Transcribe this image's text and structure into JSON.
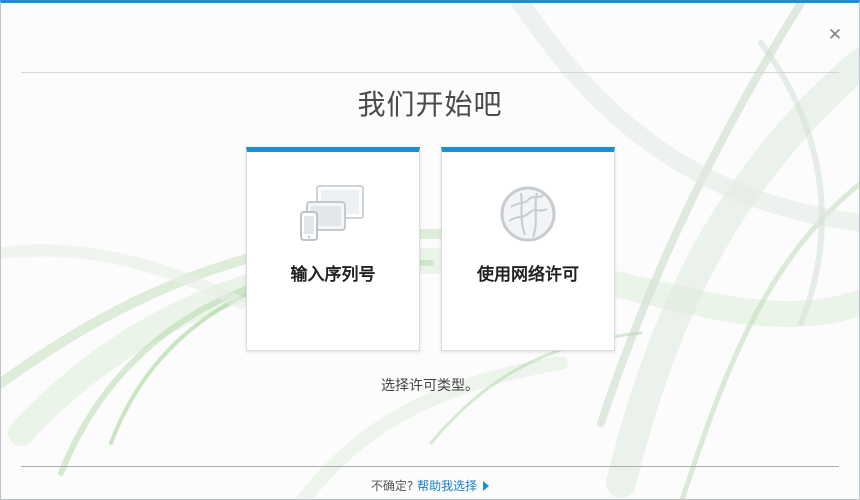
{
  "window": {
    "close_icon": "close-icon",
    "accent_color": "#1b8fd2"
  },
  "main": {
    "title": "我们开始吧",
    "cards": [
      {
        "label": "输入序列号",
        "icon": "devices-icon"
      },
      {
        "label": "使用网络许可",
        "icon": "network-globe-icon"
      }
    ],
    "subtitle": "选择许可类型。"
  },
  "footer": {
    "prompt": "不确定?",
    "help_link": "帮助我选择",
    "arrow_icon": "play-arrow-icon"
  }
}
